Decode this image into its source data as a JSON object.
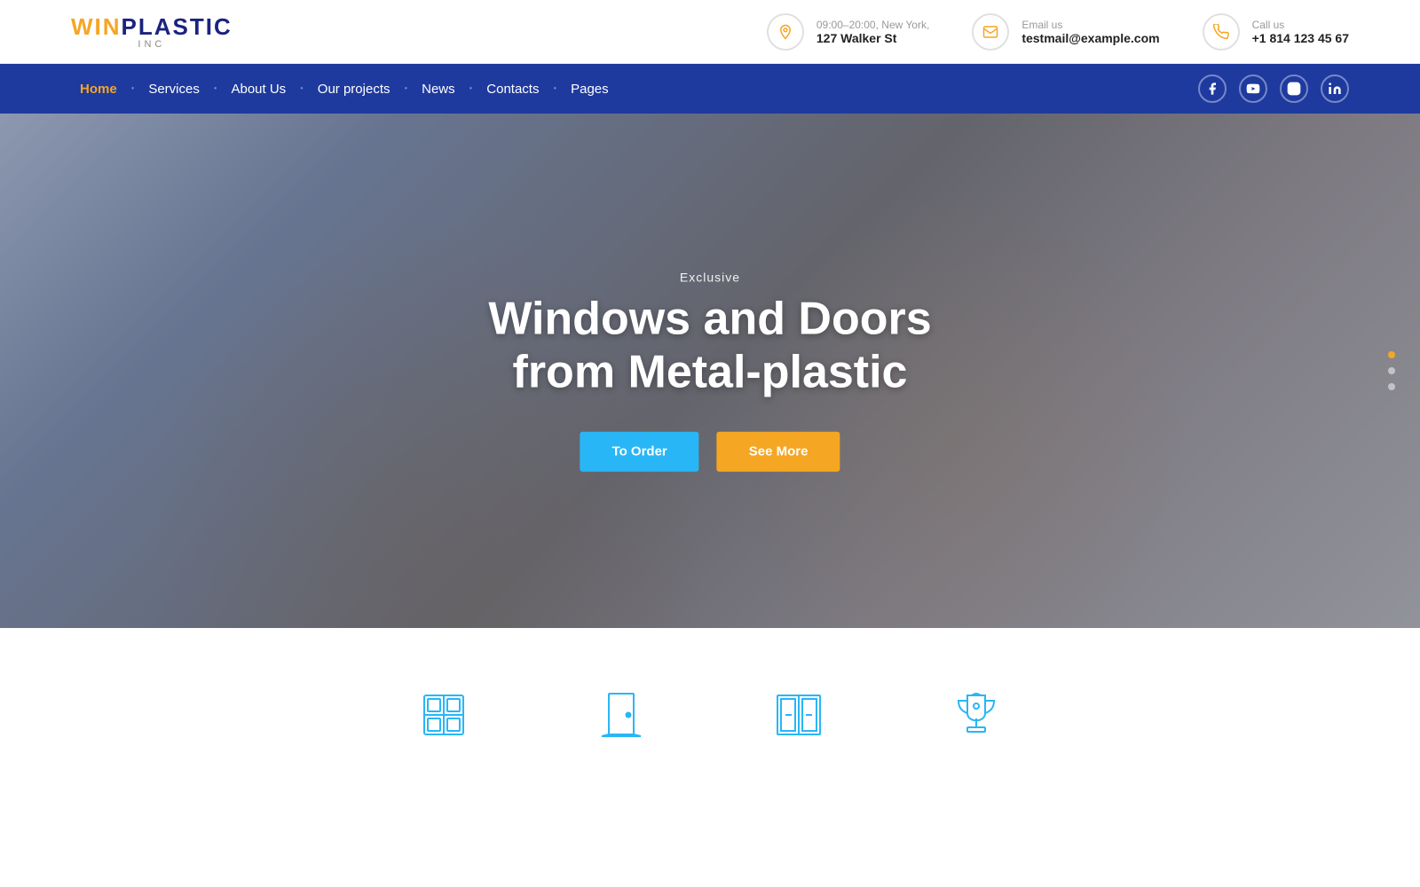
{
  "logo": {
    "main_text": "WINPLASTIC",
    "highlight_letter": "WIN",
    "sub_text": "INC"
  },
  "topbar": {
    "contact1_label": "09:00–20:00, New York,",
    "contact1_value": "127 Walker St",
    "contact2_label": "Email us",
    "contact2_value": "testmail@example.com",
    "contact3_label": "Call us",
    "contact3_value": "+1 814 123 45 67"
  },
  "nav": {
    "items": [
      {
        "label": "Home",
        "active": true
      },
      {
        "label": "Services",
        "active": false
      },
      {
        "label": "About Us",
        "active": false
      },
      {
        "label": "Our projects",
        "active": false
      },
      {
        "label": "News",
        "active": false
      },
      {
        "label": "Contacts",
        "active": false
      },
      {
        "label": "Pages",
        "active": false
      }
    ],
    "social": [
      {
        "name": "facebook"
      },
      {
        "name": "youtube"
      },
      {
        "name": "instagram"
      },
      {
        "name": "linkedin"
      }
    ]
  },
  "hero": {
    "exclusive_label": "Exclusive",
    "title_line1": "Windows and Doors",
    "title_line2": "from Metal-plastic",
    "btn_order": "To Order",
    "btn_more": "See More",
    "slides": [
      {
        "active": true
      },
      {
        "active": false
      },
      {
        "active": false
      }
    ]
  },
  "icons_section": {
    "items": [
      {
        "name": "window-icon"
      },
      {
        "name": "door-icon"
      },
      {
        "name": "balcony-icon"
      },
      {
        "name": "trophy-icon"
      }
    ]
  },
  "colors": {
    "nav_bg": "#1e3a9f",
    "active_nav": "#f5a623",
    "btn_order": "#29b6f6",
    "btn_more": "#f5a623",
    "icon_color": "#29b6f6"
  }
}
